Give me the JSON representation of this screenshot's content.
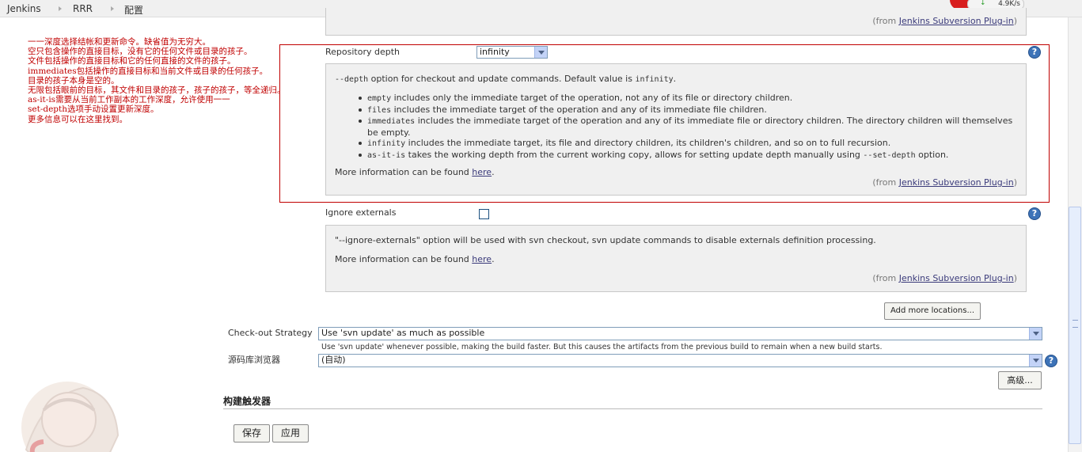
{
  "breadcrumb": [
    "Jenkins",
    "RRR",
    "配置"
  ],
  "speed": "4.9K/s",
  "annotation": "一一深度选择结帐和更新命令。缺省值为无穷大。\n空只包含操作的直接目标，没有它的任何文件或目录的孩子。\n文件包括操作的直接目标和它的任何直接的文件的孩子。\nimmediates包括操作的直接目标和当前文件或目录的任何孩子。\n目录的孩子本身是空的。\n无限包括眼前的目标，其文件和目录的孩子，孩子的孩子，等全递归。\nas-it-is需要从当前工作副本的工作深度，允许使用一一\nset-depth选项手动设置更新深度。\n更多信息可以在这里找到。",
  "top_from": {
    "prefix": "(from ",
    "link": "Jenkins Subversion Plug-in",
    "suffix": ")"
  },
  "repo_depth": {
    "label": "Repository depth",
    "value": "infinity",
    "intro": {
      "opt": "--depth",
      "text": " option for checkout and update commands. Default value is ",
      "val": "infinity",
      "end": "."
    },
    "items": [
      {
        "term": "empty",
        "text": " includes only the immediate target of the operation, not any of its file or directory children."
      },
      {
        "term": "files",
        "text": " includes the immediate target of the operation and any of its immediate file children."
      },
      {
        "term": "immediates",
        "text": " includes the immediate target of the operation and any of its immediate file or directory children. The directory children will themselves be empty."
      },
      {
        "term": "infinity",
        "text": " includes the immediate target, its file and directory children, its children's children, and so on to full recursion."
      },
      {
        "term": "as-it-is",
        "text": " takes the working depth from the current working copy, allows for setting update depth manually using ",
        "term2": "--set-depth",
        "text2": " option."
      }
    ],
    "more_prefix": "More information can be found ",
    "more_link": "here",
    "more_suffix": ".",
    "from": {
      "prefix": "(from ",
      "link": "Jenkins Subversion Plug-in",
      "suffix": ")"
    }
  },
  "ignore_externals": {
    "label": "Ignore externals",
    "checked": false,
    "help": "\"--ignore-externals\" option will be used with svn checkout, svn update commands to disable externals definition processing.",
    "more_prefix": "More information can be found ",
    "more_link": "here",
    "more_suffix": ".",
    "from": {
      "prefix": "(from ",
      "link": "Jenkins Subversion Plug-in",
      "suffix": ")"
    }
  },
  "add_locations_label": "Add more locations...",
  "checkout_strategy": {
    "label": "Check-out Strategy",
    "value": "Use 'svn update' as much as possible",
    "description": "Use 'svn update' whenever possible, making the build faster. But this causes the artifacts from the previous build to remain when a new build starts."
  },
  "repo_browser": {
    "label": "源码库浏览器",
    "value": "(自动)"
  },
  "advanced_label": "高级...",
  "build_triggers_heading": "构建触发器",
  "save_label": "保存",
  "apply_label": "应用",
  "help_glyph": "?",
  "colors": {
    "annotation": "#c00000",
    "help_icon": "#3d73b8",
    "link": "#3a3a7a"
  }
}
